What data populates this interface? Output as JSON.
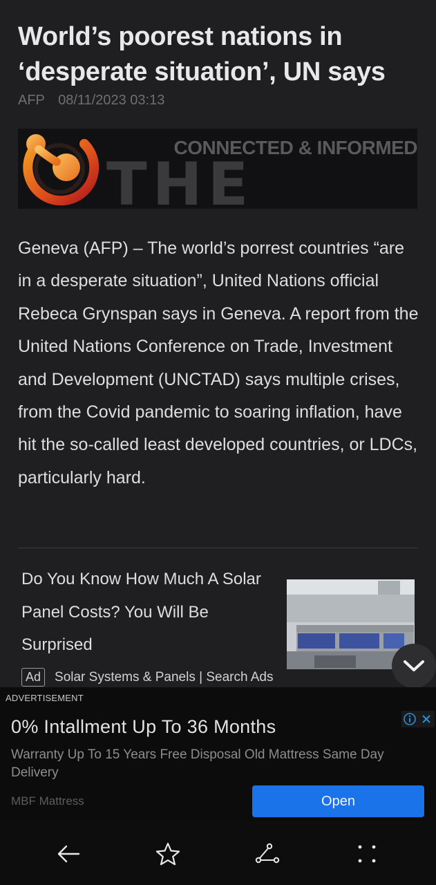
{
  "article": {
    "title": "World’s poorest nations in ‘desperate situation’, UN says",
    "source": "AFP",
    "timestamp": "08/11/2023 03:13",
    "banner": {
      "tagline": "CONNECTED & INFORMED",
      "brand": "THE FUSE"
    },
    "body": "Geneva (AFP) – The world’s porrest countries “are in a desperate situation”, United Nations official Rebeca Grynspan says in Geneva. A report from the United Nations Conference on Trade, Investment and Development (UNCTAD) says multiple crises, from the Covid pandemic to soaring inflation, have hit the so-called least developed countries, or LDCs, particularly hard."
  },
  "sponsored": {
    "title": "Do You Know How Much A Solar Panel Costs? You Will Be Surprised",
    "badge": "Ad",
    "source": "Solar Systems & Panels | Search Ads"
  },
  "advert": {
    "label": "ADVERTISEMENT",
    "headline": "0% Intallment Up To 36 Months",
    "description": "Warranty Up To 15 Years Free Disposal Old Mattress Same Day Delivery",
    "advertiser": "MBF Mattress",
    "cta": "Open"
  },
  "icons": {
    "scroll": "chevron-down-icon",
    "back": "arrow-left-icon",
    "favorite": "star-icon",
    "share": "share-icon",
    "more": "more-dots-icon"
  },
  "colors": {
    "background": "#1f1f21",
    "cta": "#1a73e8",
    "navbar": "#0d0d0e"
  }
}
